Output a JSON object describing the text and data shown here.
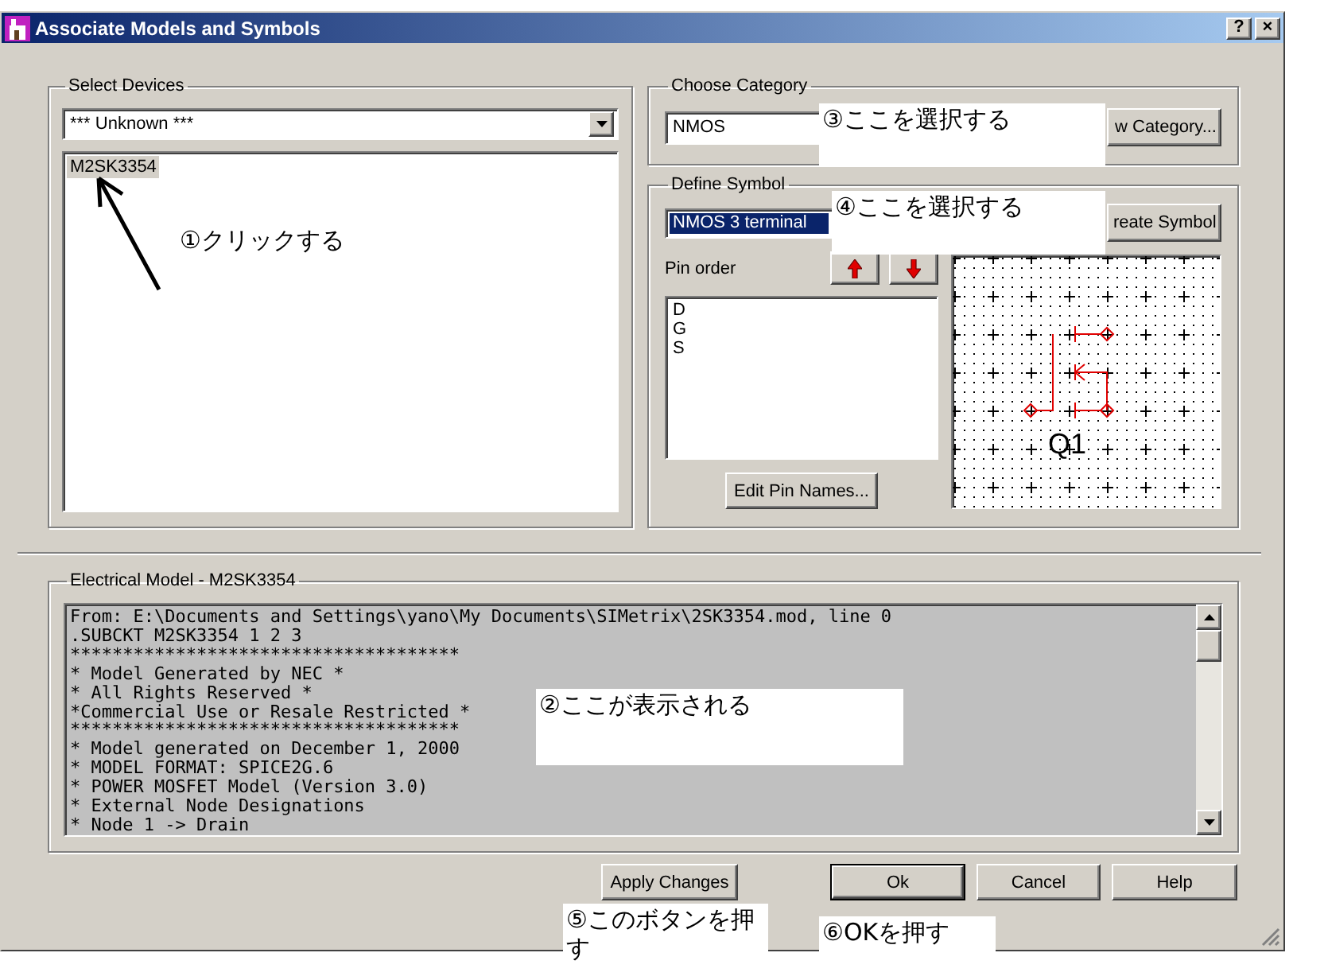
{
  "window": {
    "title": "Associate Models and Symbols",
    "title_buttons": [
      "?",
      "×"
    ]
  },
  "select_devices": {
    "label": "Select Devices",
    "dropdown": "*** Unknown ***",
    "devices": [
      {
        "name": "M2SK3354",
        "selected": true
      }
    ]
  },
  "choose_category": {
    "label": "Choose Category",
    "value": "NMOS",
    "button": "w Category..."
  },
  "define_symbol": {
    "label": "Define Symbol",
    "symbol": {
      "value": "NMOS 3 terminal",
      "selected": true
    },
    "button": "reate Symbol",
    "pin_order_label": "Pin order",
    "pins": [
      "D",
      "G",
      "S"
    ],
    "edit_button": "Edit Pin Names...",
    "preview_label": "Q1"
  },
  "electrical_model": {
    "label": "Electrical Model - M2SK3354",
    "lines": [
      "From: E:\\Documents and Settings\\yano\\My Documents\\SIMetrix\\2SK3354.mod, line 0",
      ".SUBCKT M2SK3354 1 2 3",
      "*************************************",
      "* Model Generated by NEC *",
      "* All Rights Reserved *",
      "*Commercial Use or Resale Restricted *",
      "*************************************",
      "* Model generated on December 1, 2000",
      "* MODEL FORMAT: SPICE2G.6",
      "* POWER MOSFET Model (Version 3.0)",
      "* External Node Designations",
      "* Node 1 -> Drain"
    ]
  },
  "buttons": [
    {
      "label": "Apply Changes",
      "default": false
    },
    {
      "label": "Ok",
      "default": true
    },
    {
      "label": "Cancel",
      "default": false
    },
    {
      "label": "Help",
      "default": false
    }
  ],
  "annotations": [
    {
      "text": "①クリックする",
      "boxed": false
    },
    {
      "text": "②ここが表示される",
      "boxed": true
    },
    {
      "text": "③ここを選択する",
      "boxed": true
    },
    {
      "text": "④ここを選択する",
      "boxed": true
    },
    {
      "text": "⑤このボタンを押す",
      "boxed": true
    },
    {
      "text": "⑥OKを押す",
      "boxed": true
    }
  ]
}
